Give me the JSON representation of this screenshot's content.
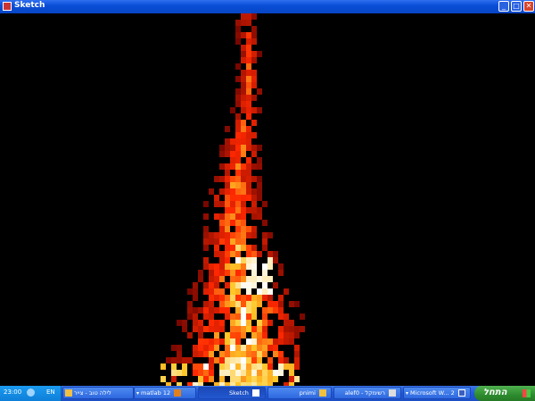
{
  "window": {
    "title": "Sketch",
    "minimize_glyph": "_",
    "maximize_glyph": "□",
    "close_glyph": "✕"
  },
  "taskbar": {
    "clock": "23:00",
    "language": "EN",
    "tasks": [
      {
        "label": "לילה טוב - צייר",
        "icon": "paint-icon"
      },
      {
        "label": "matlab  12",
        "icon": "matlab-icon"
      },
      {
        "label": "Sketch",
        "icon": "window-icon"
      },
      {
        "label": "pnimi",
        "icon": "folder-icon"
      },
      {
        "label": "alef0 - רשימקל",
        "icon": "document-icon"
      },
      {
        "label": "Microsoft W...  2",
        "icon": "word-icon"
      }
    ],
    "start_label": "התחל"
  },
  "colors": {
    "title_bar": "#0a4fd8",
    "taskbar": "#2257d6",
    "start_button": "#2e8b2e",
    "background": "#000000",
    "heat_low": "#6a0a00",
    "heat_high": "#ffffff"
  }
}
